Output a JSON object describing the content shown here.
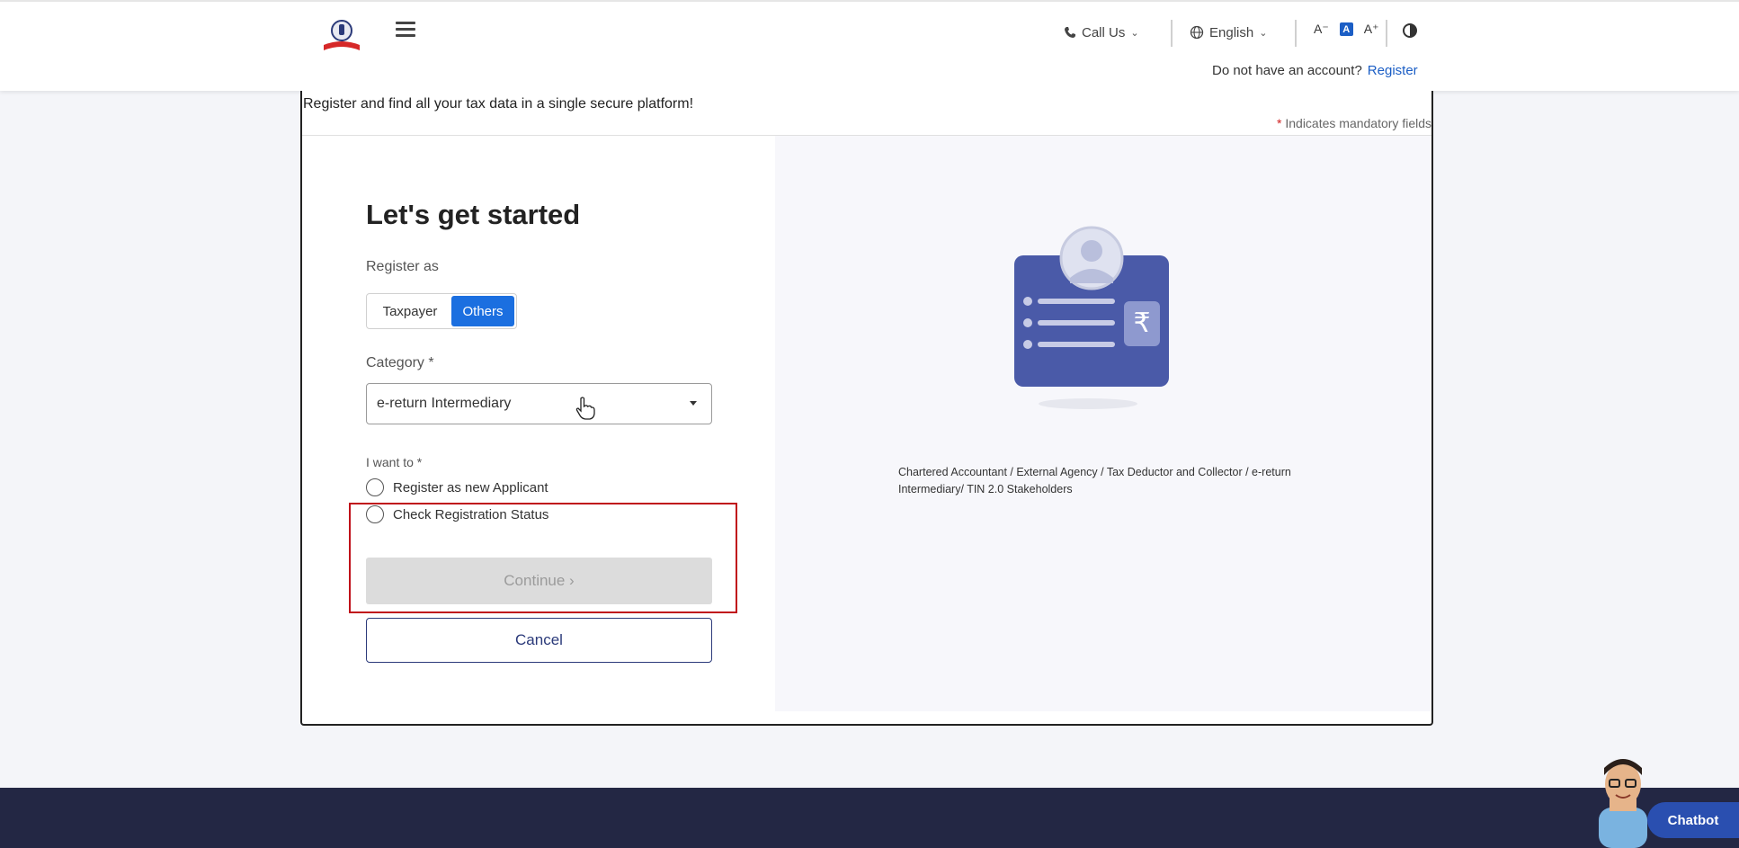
{
  "header": {
    "call_us": "Call Us",
    "language": "English",
    "font_decrease": "A⁻",
    "font_normal": "A",
    "font_increase": "A⁺",
    "account_prompt": "Do not have an account?",
    "register_link": "Register"
  },
  "page": {
    "subheading": "Register and find all your tax data in a single secure platform!",
    "mandatory_star": "*",
    "mandatory_note": "Indicates mandatory fields"
  },
  "form": {
    "title": "Let's get started",
    "register_as_label": "Register as",
    "toggle": {
      "taxpayer": "Taxpayer",
      "others": "Others",
      "selected": "Others"
    },
    "category_label": "Category *",
    "category_value": "e-return Intermediary",
    "i_want_to_label": "I want to *",
    "options": [
      "Register as new Applicant",
      "Check Registration Status"
    ],
    "continue_label": "Continue ›",
    "cancel_label": "Cancel"
  },
  "illustration": {
    "caption": "Chartered Accountant / External Agency / Tax Deductor and Collector / e-return Intermediary/ TIN 2.0 Stakeholders"
  },
  "chatbot": {
    "label": "Chatbot"
  },
  "colors": {
    "primary": "#1b6fe0",
    "navy": "#2b3a7a",
    "footer": "#232744",
    "highlight": "#c0101a",
    "illustration": "#4a5aa8"
  }
}
